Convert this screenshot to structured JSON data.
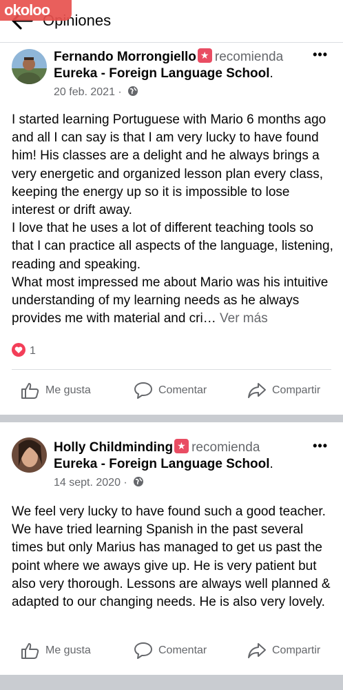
{
  "topbar": {
    "title": "Opiniones",
    "watermark": "okoloo"
  },
  "posts": [
    {
      "author": "Fernando Morrongiello",
      "recommends": "recomienda",
      "page": "Eureka - Foreign Language School",
      "date": "20 feb. 2021",
      "paragraphs": [
        "I started learning Portuguese with Mario 6 months ago and all I can say is that I am very lucky to have found him! His classes are a delight and he always brings a very energetic and organized lesson plan every class, keeping the energy up so it is impossible to lose interest or drift away.",
        "I love that he uses a lot of different teaching tools so that I can practice all aspects of the language, listening, reading and speaking.",
        "What most impressed me about Mario was his intuitive understanding of my learning needs as he always provides me with material and cri…"
      ],
      "see_more": "Ver más",
      "reaction_count": "1",
      "actions": {
        "like": "Me gusta",
        "comment": "Comentar",
        "share": "Compartir"
      }
    },
    {
      "author": "Holly Childminding",
      "recommends": "recomienda",
      "page": "Eureka - Foreign Language School",
      "date": "14 sept. 2020",
      "paragraphs": [
        "We feel very lucky to have found such a good teacher. We have tried learning Spanish in the past several times but only Marius has managed to get us past the point where we aways give up. He is very patient but also very thorough. Lessons are always well planned & adapted to our changing needs. He is also very lovely."
      ],
      "actions": {
        "like": "Me gusta",
        "comment": "Comentar",
        "share": "Compartir"
      }
    }
  ],
  "colors": {
    "secondary_text": "#65676b",
    "recommend_badge": "#e94d63",
    "heart": "#f33e58",
    "separator": "#c9ccd1"
  }
}
